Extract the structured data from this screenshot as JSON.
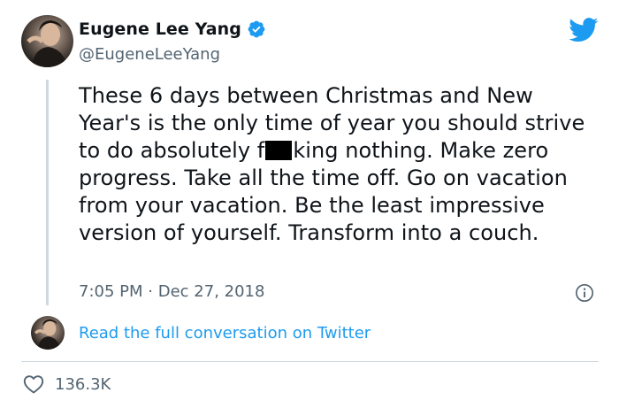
{
  "author": {
    "display_name": "Eugene Lee Yang",
    "handle": "@EugeneLeeYang",
    "verified": true
  },
  "tweet": {
    "text_before": "These 6 days between Christmas and New Year's is the only time of year you should strive to do absolutely f",
    "text_after": "king nothing. Make zero progress. Take all the time off. Go on vacation from your vacation. Be the least impressive version of yourself. Transform into a couch.",
    "time": "7:05 PM",
    "separator": "·",
    "date": "Dec 27, 2018"
  },
  "conversation_link": "Read the full conversation on Twitter",
  "likes": {
    "count": "136.3K"
  },
  "icons": {
    "brand": "twitter-bird-icon",
    "verified": "verified-badge-icon",
    "info": "info-icon",
    "like": "heart-icon"
  },
  "colors": {
    "accent": "#1d9bf0",
    "text": "#0f1419",
    "muted": "#536471",
    "divider": "#cfd9de"
  }
}
